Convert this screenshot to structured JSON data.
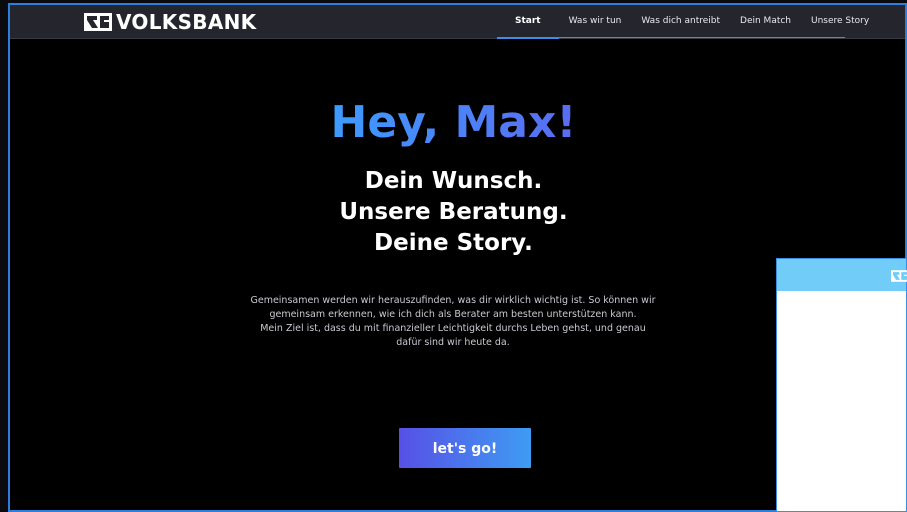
{
  "brand": {
    "name": "VOLKSBANK",
    "accent": "#3b8fe8",
    "gradient_start": "#3d9bff",
    "gradient_end": "#5a6cf2",
    "icon": "volksbank-logo-icon"
  },
  "nav": {
    "items": [
      {
        "label": "Start",
        "active": true
      },
      {
        "label": "Was wir tun",
        "active": false
      },
      {
        "label": "Was dich antreibt",
        "active": false
      },
      {
        "label": "Dein Match",
        "active": false
      },
      {
        "label": "Unsere Story",
        "active": false
      }
    ]
  },
  "hero": {
    "greeting": "Hey, Max!",
    "tagline": [
      "Dein Wunsch.",
      "Unsere Beratung.",
      "Deine Story."
    ],
    "intro": [
      "Gemeinsamen werden wir herauszufinden, was dir wirklich wichtig ist. So können wir",
      "gemeinsam erkennen, wie ich dich als Berater am besten unterstützen kann.",
      "Mein Ziel ist, dass du mit finanzieller Leichtigkeit durchs Leben gehst, und genau",
      "dafür sind wir heute da."
    ],
    "cta_label": "let's go!"
  },
  "overlay": {
    "header_color": "#71ccf7",
    "icon": "volksbank-logo-icon"
  }
}
